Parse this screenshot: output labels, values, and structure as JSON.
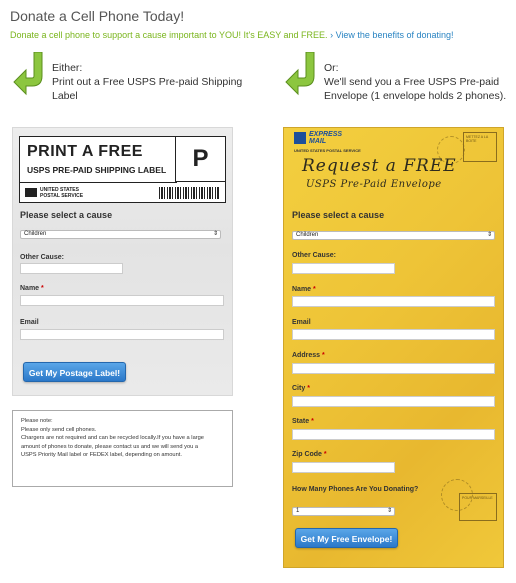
{
  "page": {
    "title": "Donate a Cell Phone Today!",
    "intro_text": "Donate a cell phone to support a cause important to YOU! It's EASY and FREE.",
    "intro_link": "› View the benefits of donating!"
  },
  "options": {
    "left_text_1": "Either:",
    "left_text_2": "Print out a Free USPS Pre-paid Shipping",
    "left_text_3": "Label",
    "right_text_1": "Or:",
    "right_text_2": "We'll send you a Free USPS Pre-paid",
    "right_text_3": "Envelope (1 envelope holds 2 phones)."
  },
  "left_panel": {
    "label_title": "PRINT A FREE",
    "label_sub": "USPS PRE-PAID SHIPPING LABEL",
    "label_letter": "P",
    "usps_line1": "UNITED STATES",
    "usps_line2": "POSTAL SERVICE",
    "cause_heading": "Please select a cause",
    "cause_selected": "Children",
    "other_cause_label": "Other Cause:",
    "name_label": "Name",
    "email_label": "Email",
    "required_mark": "*",
    "button_label": "Get My Postage Label!"
  },
  "note": {
    "line1": "Please note:",
    "line2": "Please only send cell phones.",
    "line3": "Chargers are not required and can be recycled locally.If you have a large",
    "line4": "amount of phones to donate, please contact us and we will send you a",
    "line5": "USPS Priority Mail label or FEDEX label, depending on amount."
  },
  "right_panel": {
    "express_line1": "EXPRESS",
    "express_line2": "MAIL",
    "usps_small": "UNITED STATES POSTAL SERVICE",
    "title": "Request a FREE",
    "subtitle": "USPS Pre-Paid Envelope",
    "stamp_text": "METTEZ A LA BOITE",
    "stamp_text2": "POUR MARSEILLE",
    "cause_heading": "Please select a cause",
    "cause_selected": "Children",
    "other_cause_label": "Other Cause:",
    "name_label": "Name",
    "email_label": "Email",
    "address_label": "Address",
    "city_label": "City",
    "state_label": "State",
    "zip_label": "Zip Code",
    "phones_label": "How Many Phones Are You Donating?",
    "phones_selected": "1",
    "required_mark": "*",
    "button_label": "Get My Free Envelope!"
  },
  "colors": {
    "accent_green": "#7ab51d",
    "link_blue": "#2a84c2",
    "button_blue": "#2b78c9",
    "envelope_yellow": "#eec437"
  }
}
